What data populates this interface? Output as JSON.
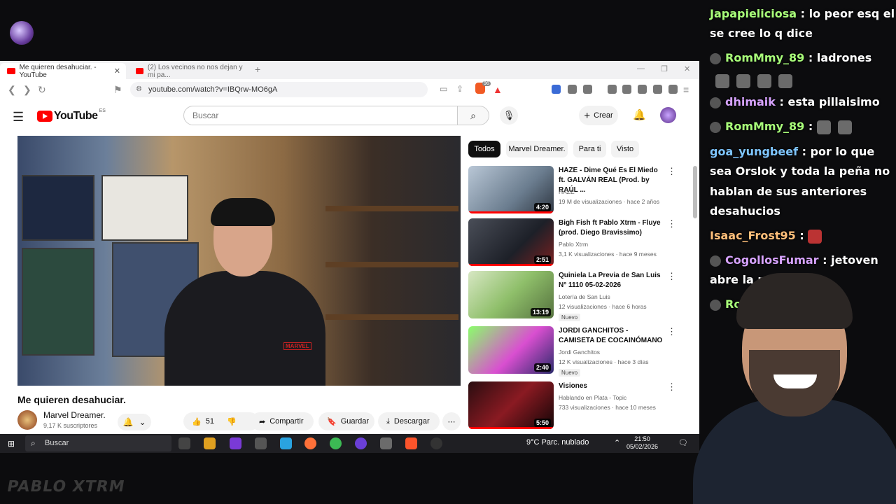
{
  "browser": {
    "tabs": [
      {
        "label": "Me quieren desahuciar. - YouTube"
      },
      {
        "label": "(2) Los vecinos no nos dejan y mi pa..."
      }
    ],
    "url": "youtube.com/watch?v=IBQrw-MO6gA",
    "shield_badge": "96"
  },
  "youtube": {
    "logo_text": "YouTube",
    "country_code": "ES",
    "search_placeholder": "Buscar",
    "create_label": "Crear",
    "video": {
      "title": "Me quieren desahuciar.",
      "channel": "Marvel Dreamer.",
      "subscribers": "9,17 K suscriptores",
      "likes": "51",
      "share_label": "Compartir",
      "save_label": "Guardar",
      "download_label": "Descargar",
      "shirt_text": "MARVEL"
    },
    "chips": [
      "Todos",
      "Marvel Dreamer.",
      "Para ti",
      "Visto"
    ],
    "recommendations": [
      {
        "title": "HAZE - Dime Qué Es El Miedo ft. GALVÁN REAL (Prod. by RAÚL ...",
        "channel": "HAZE",
        "meta": "19 M de visualizaciones · hace 2 años",
        "duration": "4:20",
        "badge": ""
      },
      {
        "title": "Bigh Fish ft Pablo Xtrm - Fluye (prod. Diego Bravissimo)",
        "channel": "Pablo Xtrm",
        "meta": "3,1 K visualizaciones · hace 9 meses",
        "duration": "2:51",
        "badge": ""
      },
      {
        "title": "Quiniela La Previa de San Luis N° 1110 05-02-2026",
        "channel": "Lotería de San Luis",
        "meta": "12 visualizaciones · hace 6 horas",
        "duration": "13:19",
        "badge": "Nuevo"
      },
      {
        "title": "JORDI GANCHITOS - CAMISETA DE COCAINÓMANO",
        "channel": "Jordi Ganchitos",
        "meta": "12 K visualizaciones · hace 3 días",
        "duration": "2:40",
        "badge": "Nuevo"
      },
      {
        "title": "Visiones",
        "channel": "Hablando en Plata - Topic",
        "meta": "733 visualizaciones · hace 10 meses",
        "duration": "5:50",
        "badge": ""
      }
    ]
  },
  "taskbar": {
    "search_placeholder": "Buscar",
    "weather": "9°C  Parc. nublado",
    "time": "21:50",
    "date": "05/02/2026"
  },
  "chat": [
    {
      "user": "Japapieliciosa",
      "text": ": lo peor esq el"
    },
    {
      "user": "",
      "text": "se cree lo q dice"
    },
    {
      "user": "RomMmy_89",
      "text": ": ladrones"
    },
    {
      "user": "dhimaik",
      "text": ": esta pillaisimo"
    },
    {
      "user": "RomMmy_89",
      "text": ":"
    },
    {
      "user": "goa_yungbeef",
      "text": ": por lo que"
    },
    {
      "user": "",
      "text": "sea Orslok y toda la peña no"
    },
    {
      "user": "",
      "text": "hablan de sus anteriores"
    },
    {
      "user": "",
      "text": "desahucios"
    },
    {
      "user": "Isaac_Frost95",
      "text": ":"
    },
    {
      "user": "CogollosFumar",
      "text": ": jetoven"
    },
    {
      "user": "",
      "text": "abre la pu"
    },
    {
      "user": "Ro",
      "text": ""
    }
  ],
  "overlay": {
    "brand": "PABLO XTRM"
  }
}
